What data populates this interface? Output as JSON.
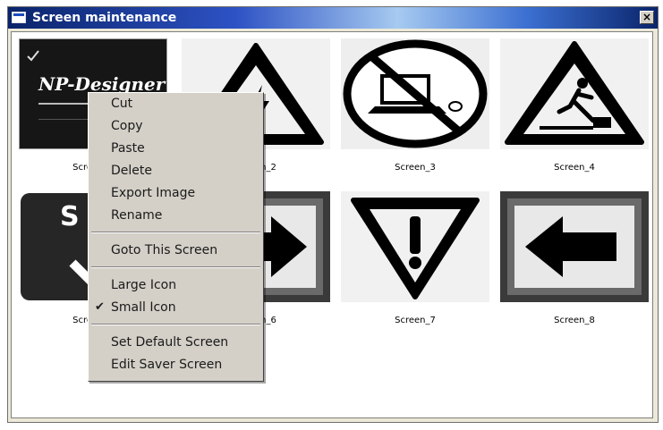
{
  "window": {
    "title": "Screen maintenance",
    "close_label": "×"
  },
  "screens": [
    {
      "caption": "Screen_1",
      "logo_text": "NP-Designer"
    },
    {
      "caption": "Screen_2"
    },
    {
      "caption": "Screen_3"
    },
    {
      "caption": "Screen_4"
    },
    {
      "caption": "Screen_5",
      "sign_text": "S"
    },
    {
      "caption": "Screen_6"
    },
    {
      "caption": "Screen_7"
    },
    {
      "caption": "Screen_8"
    }
  ],
  "context_menu": {
    "items": [
      {
        "label": "Cut"
      },
      {
        "label": "Copy"
      },
      {
        "label": "Paste"
      },
      {
        "label": "Delete"
      },
      {
        "label": "Export Image"
      },
      {
        "label": "Rename"
      },
      {
        "label": "Goto This Screen"
      },
      {
        "label": "Large Icon"
      },
      {
        "label": "Small Icon",
        "checked": true,
        "check_glyph": "✔"
      },
      {
        "label": "Set Default Screen"
      },
      {
        "label": "Edit Saver Screen"
      }
    ]
  }
}
